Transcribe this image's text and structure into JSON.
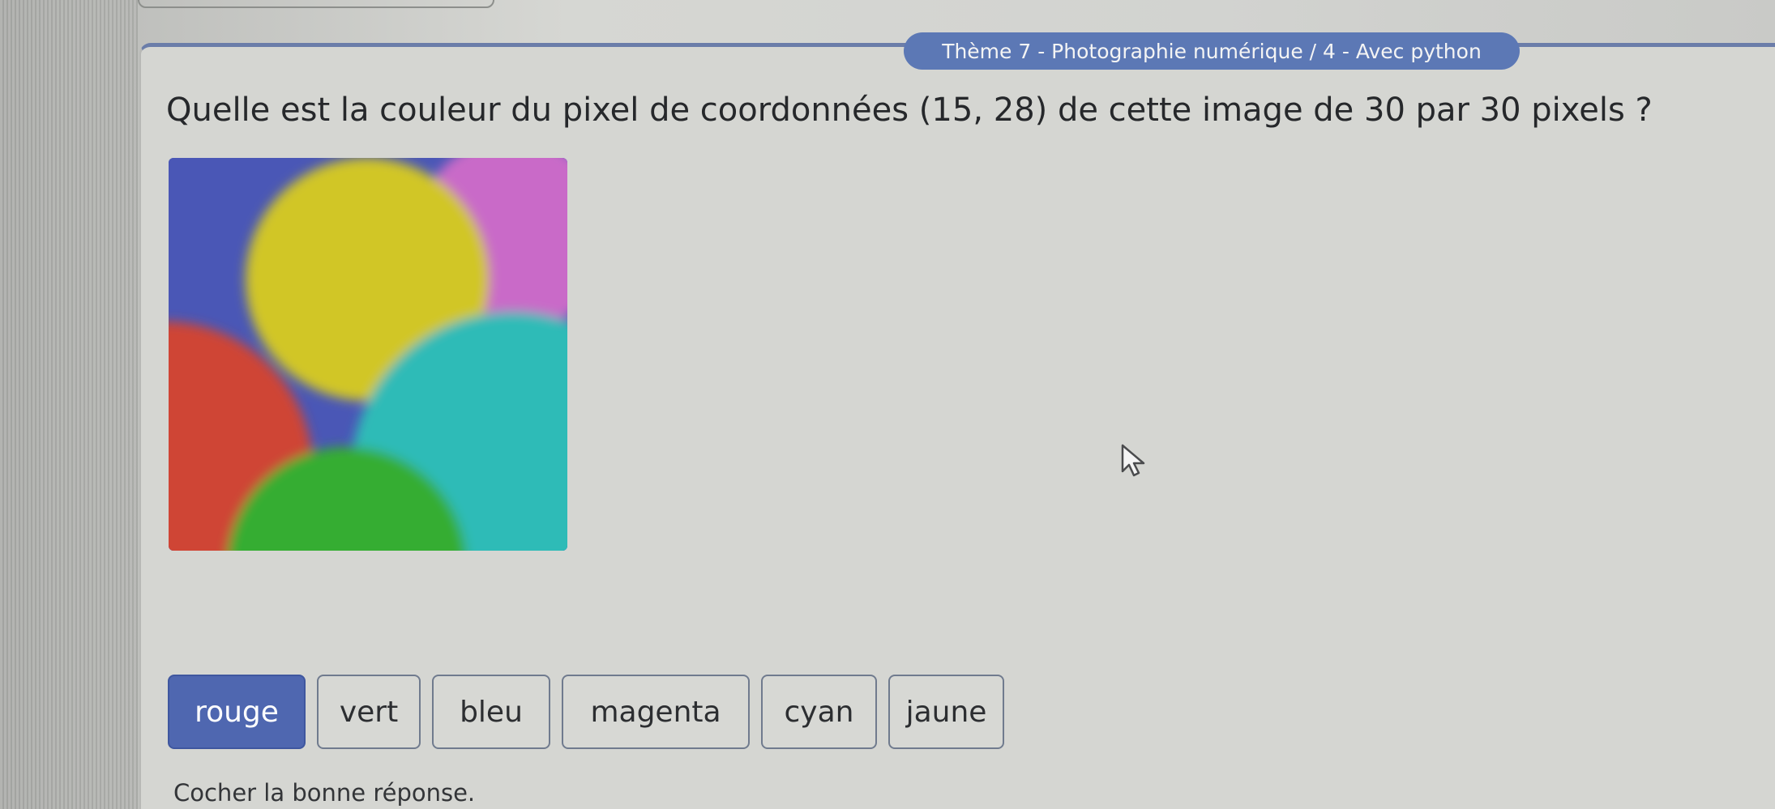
{
  "header": {
    "theme_title": "Thème 7 - Photographie numérique / 4 - Avec python"
  },
  "question": {
    "text": "Quelle est la couleur du pixel de coordonnées (15, 28) de cette image de 30 par 30 pixels ?"
  },
  "answers": [
    {
      "label": "rouge",
      "selected": true
    },
    {
      "label": "vert",
      "selected": false
    },
    {
      "label": "bleu",
      "selected": false
    },
    {
      "label": "magenta",
      "selected": false
    },
    {
      "label": "cyan",
      "selected": false
    },
    {
      "label": "jaune",
      "selected": false
    }
  ],
  "footer": {
    "hint": "Cocher la bonne réponse."
  },
  "colors": {
    "accent": "#5c78b5",
    "selected_answer": "#4f67b0",
    "image_blue": "#4a57b6",
    "image_yellow": "#d1c628",
    "image_magenta": "#c96bc8",
    "image_red": "#cf4436",
    "image_green": "#35ad31",
    "image_cyan": "#2fbbb7"
  }
}
